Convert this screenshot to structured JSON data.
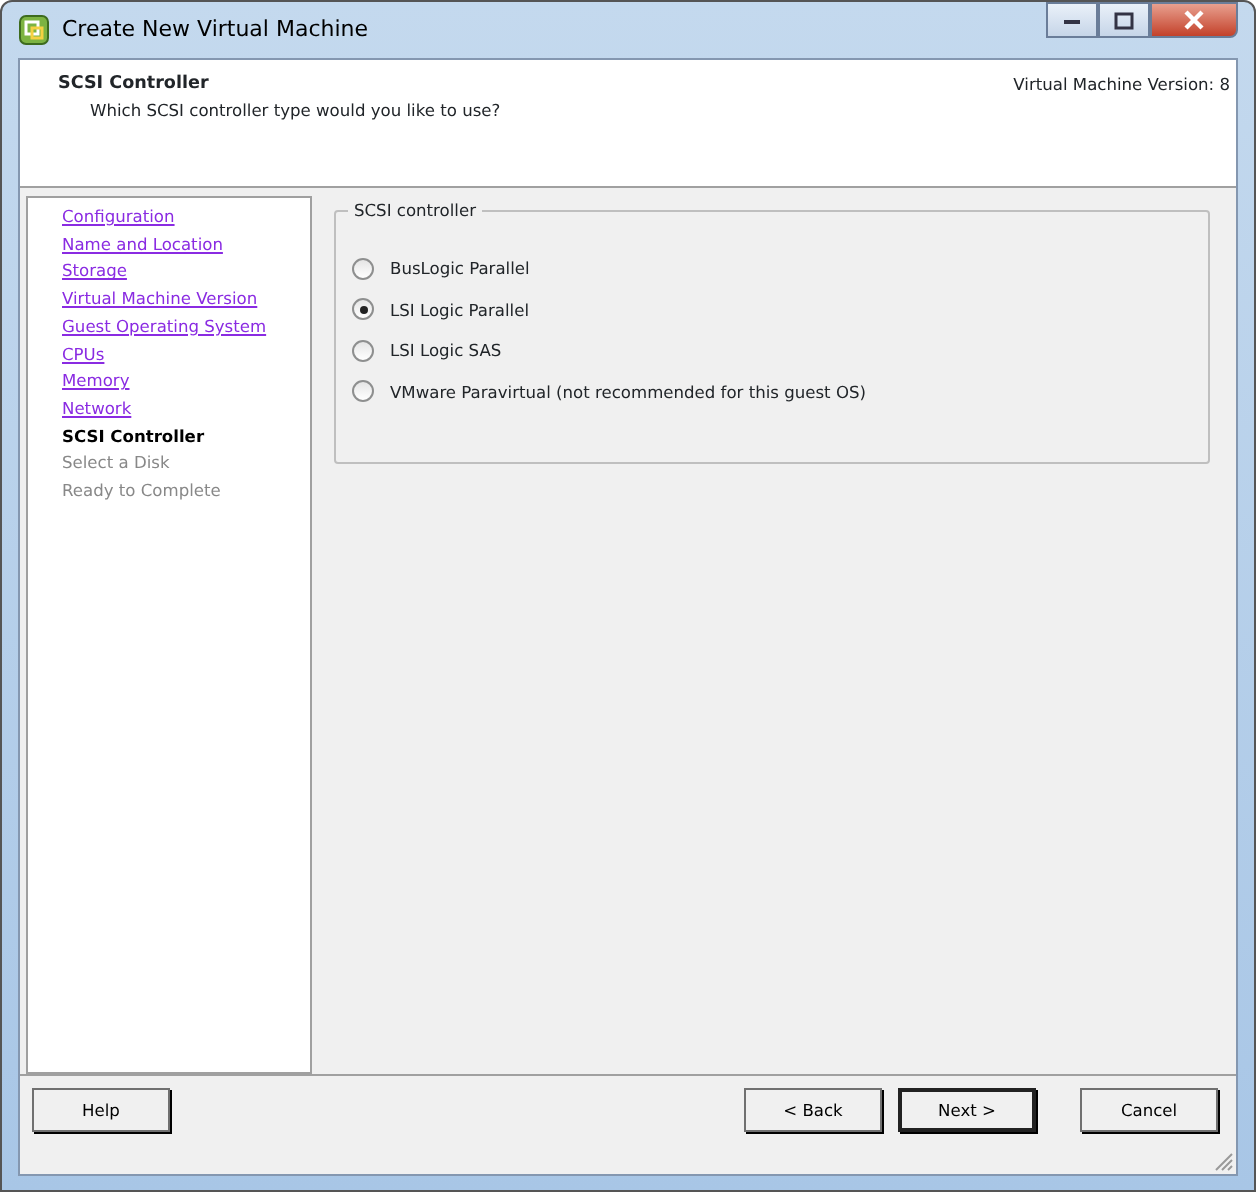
{
  "window": {
    "title": "Create New Virtual Machine"
  },
  "header": {
    "title": "SCSI Controller",
    "subtitle": "Which SCSI controller type would you like to use?",
    "version": "Virtual Machine Version: 8"
  },
  "steps": [
    {
      "label": "Configuration",
      "visited": true,
      "selected": false
    },
    {
      "label": "Name and Location",
      "visited": true,
      "selected": false
    },
    {
      "label": "Storage",
      "visited": true,
      "selected": false
    },
    {
      "label": "Virtual Machine Version",
      "visited": true,
      "selected": false
    },
    {
      "label": "Guest Operating System",
      "visited": true,
      "selected": false
    },
    {
      "label": "CPUs",
      "visited": true,
      "selected": false
    },
    {
      "label": "Memory",
      "visited": true,
      "selected": false
    },
    {
      "label": "Network",
      "visited": true,
      "selected": false
    },
    {
      "label": "SCSI Controller",
      "visited": false,
      "selected": true
    },
    {
      "label": "Select a Disk",
      "visited": false,
      "selected": false
    },
    {
      "label": "Ready to Complete",
      "visited": false,
      "selected": false
    }
  ],
  "group": {
    "title": "SCSI controller",
    "options": [
      {
        "label": "BusLogic Parallel",
        "selected": false
      },
      {
        "label": "LSI Logic Parallel",
        "selected": true
      },
      {
        "label": "LSI Logic SAS",
        "selected": false
      },
      {
        "label": "VMware Paravirtual (not recommended for this guest OS)",
        "selected": false
      }
    ]
  },
  "left_buttons": [
    {
      "label": "Help",
      "default": false
    }
  ],
  "right_buttons": [
    {
      "label": "< Back",
      "default": false
    },
    {
      "label": "Next >",
      "default": true
    },
    {
      "label": "Cancel",
      "default": false
    }
  ]
}
